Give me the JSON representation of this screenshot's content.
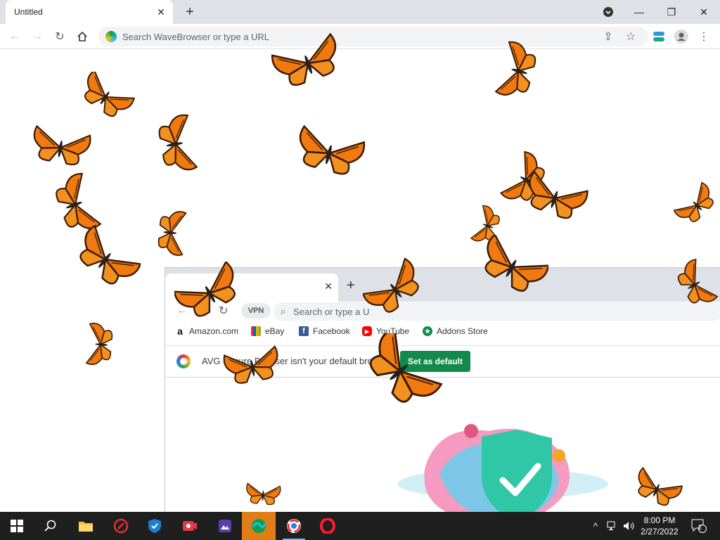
{
  "browser": {
    "tab_title": "Untitled",
    "omnibox_placeholder": "Search WaveBrowser or type a URL"
  },
  "inner_browser": {
    "vpn_label": "VPN",
    "omnibox_placeholder": "Search or type a U",
    "bookmarks": [
      {
        "label": "Amazon.com",
        "icon": "amazon-icon"
      },
      {
        "label": "eBay",
        "icon": "ebay-icon"
      },
      {
        "label": "Facebook",
        "icon": "facebook-icon"
      },
      {
        "label": "YouTube",
        "icon": "youtube-icon"
      },
      {
        "label": "Addons Store",
        "icon": "addons-store-icon"
      }
    ],
    "infobar": {
      "message": "AVG Secure Browser isn't your default browser",
      "button_label": "Set as default"
    }
  },
  "taskbar": {
    "apps": [
      "windows-start-icon",
      "search-icon",
      "file-explorer-icon",
      "app-red-icon",
      "shield-app-icon",
      "video-app-icon",
      "image-app-icon",
      "wavebrowser-icon",
      "avg-browser-icon",
      "opera-icon"
    ],
    "time": "8:00 PM",
    "date": "2/27/2022",
    "notification_count": "2"
  },
  "colors": {
    "butterfly_orange": "#f07a10",
    "infobar_button": "#138a4b",
    "taskbar_active": "#e07d17"
  }
}
